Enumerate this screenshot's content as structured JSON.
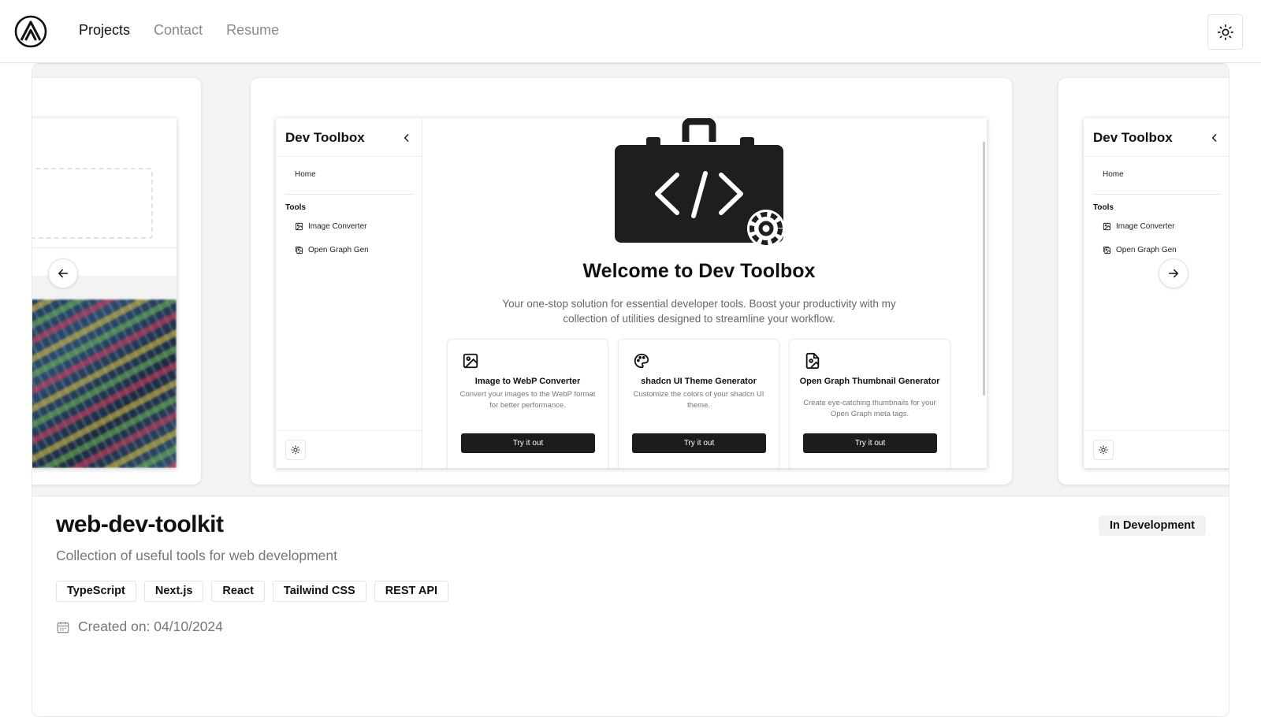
{
  "nav": {
    "items": [
      {
        "label": "Projects",
        "active": true
      },
      {
        "label": "Contact",
        "active": false
      },
      {
        "label": "Resume",
        "active": false
      }
    ]
  },
  "theme_toggle_icon": "sun-icon",
  "carousel": {
    "prev_icon": "arrow-left-icon",
    "next_icon": "arrow-right-icon"
  },
  "devtoolbox": {
    "title": "Dev Toolbox",
    "home": "Home",
    "tools_heading": "Tools",
    "tools": [
      "Image Converter",
      "Open Graph Gen"
    ],
    "welcome": "Welcome to Dev Toolbox",
    "subtitle": "Your one-stop solution for essential developer tools. Boost your productivity with my collection of utilities designed to streamline your workflow.",
    "cards": [
      {
        "icon": "image-icon",
        "title": "Image to WebP Converter",
        "desc": "Convert your images to the WebP format for better performance.",
        "button": "Try it out"
      },
      {
        "icon": "palette-icon",
        "title": "shadcn UI Theme Generator",
        "desc": "Customize the colors of your shadcn UI theme.",
        "button": "Try it out"
      },
      {
        "icon": "file-image-icon",
        "title": "Open Graph Thumbnail Generator",
        "desc": "Create eye-catching thumbnails for your Open Graph meta tags.",
        "button": "Try it out"
      }
    ]
  },
  "project": {
    "title": "web-dev-toolkit",
    "status": "In Development",
    "description": "Collection of useful tools for web development",
    "tags": [
      "TypeScript",
      "Next.js",
      "React",
      "Tailwind CSS",
      "REST API"
    ],
    "created": "Created on: 04/10/2024"
  }
}
